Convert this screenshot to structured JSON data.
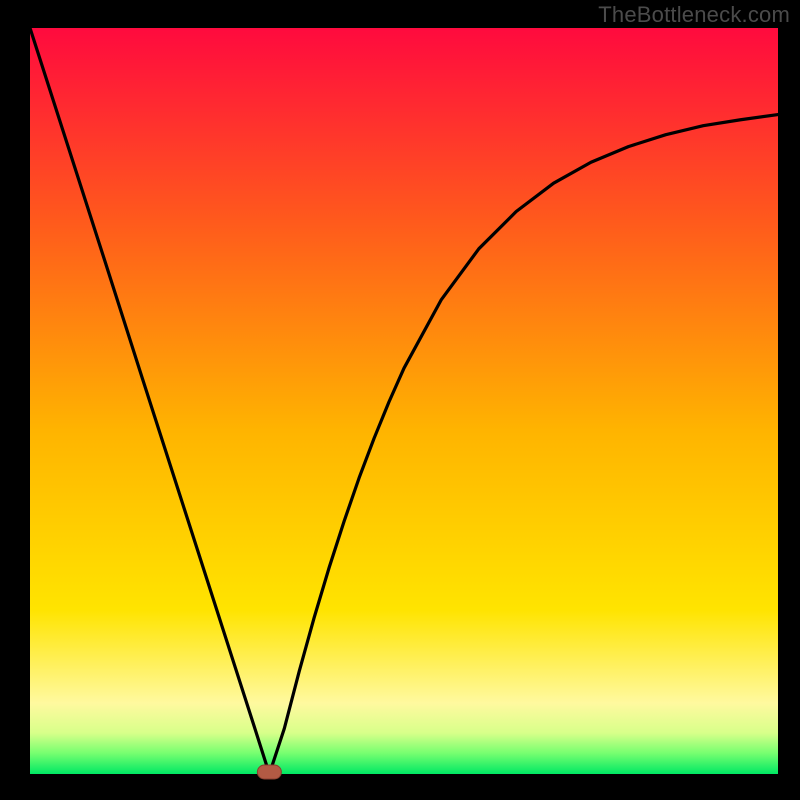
{
  "watermark": "TheBottleneck.com",
  "colors": {
    "frame": "#000000",
    "grad_top": "#ff0a3e",
    "grad_upper_mid": "#ff5a1c",
    "grad_mid": "#ffb400",
    "grad_lower_mid": "#ffe400",
    "grad_low1": "#fff99f",
    "grad_low2": "#d8ff8a",
    "grad_low3": "#77ff70",
    "grad_bottom": "#00e864",
    "curve": "#000000",
    "marker_fill": "#b35a44",
    "marker_stroke": "#8b3f2f"
  },
  "chart_data": {
    "type": "line",
    "title": "",
    "xlabel": "",
    "ylabel": "",
    "xlim": [
      0,
      100
    ],
    "ylim": [
      0,
      100
    ],
    "grid": false,
    "legend": false,
    "series": [
      {
        "name": "bottleneck-curve",
        "x": [
          0,
          5,
          10,
          15,
          20,
          25,
          30,
          32,
          34,
          36,
          38,
          40,
          42,
          44,
          46,
          48,
          50,
          55,
          60,
          65,
          70,
          75,
          80,
          85,
          90,
          95,
          100
        ],
        "y": [
          100,
          84.4,
          68.8,
          53.1,
          37.5,
          21.9,
          6.3,
          0.0,
          6.1,
          13.8,
          21.0,
          27.7,
          33.9,
          39.7,
          45.0,
          49.9,
          54.4,
          63.6,
          70.4,
          75.4,
          79.2,
          82.0,
          84.1,
          85.7,
          86.9,
          87.7,
          88.4
        ]
      }
    ],
    "annotations": [
      {
        "name": "optimum-marker",
        "x": 32,
        "y": 0,
        "shape": "rounded-rect"
      }
    ]
  }
}
